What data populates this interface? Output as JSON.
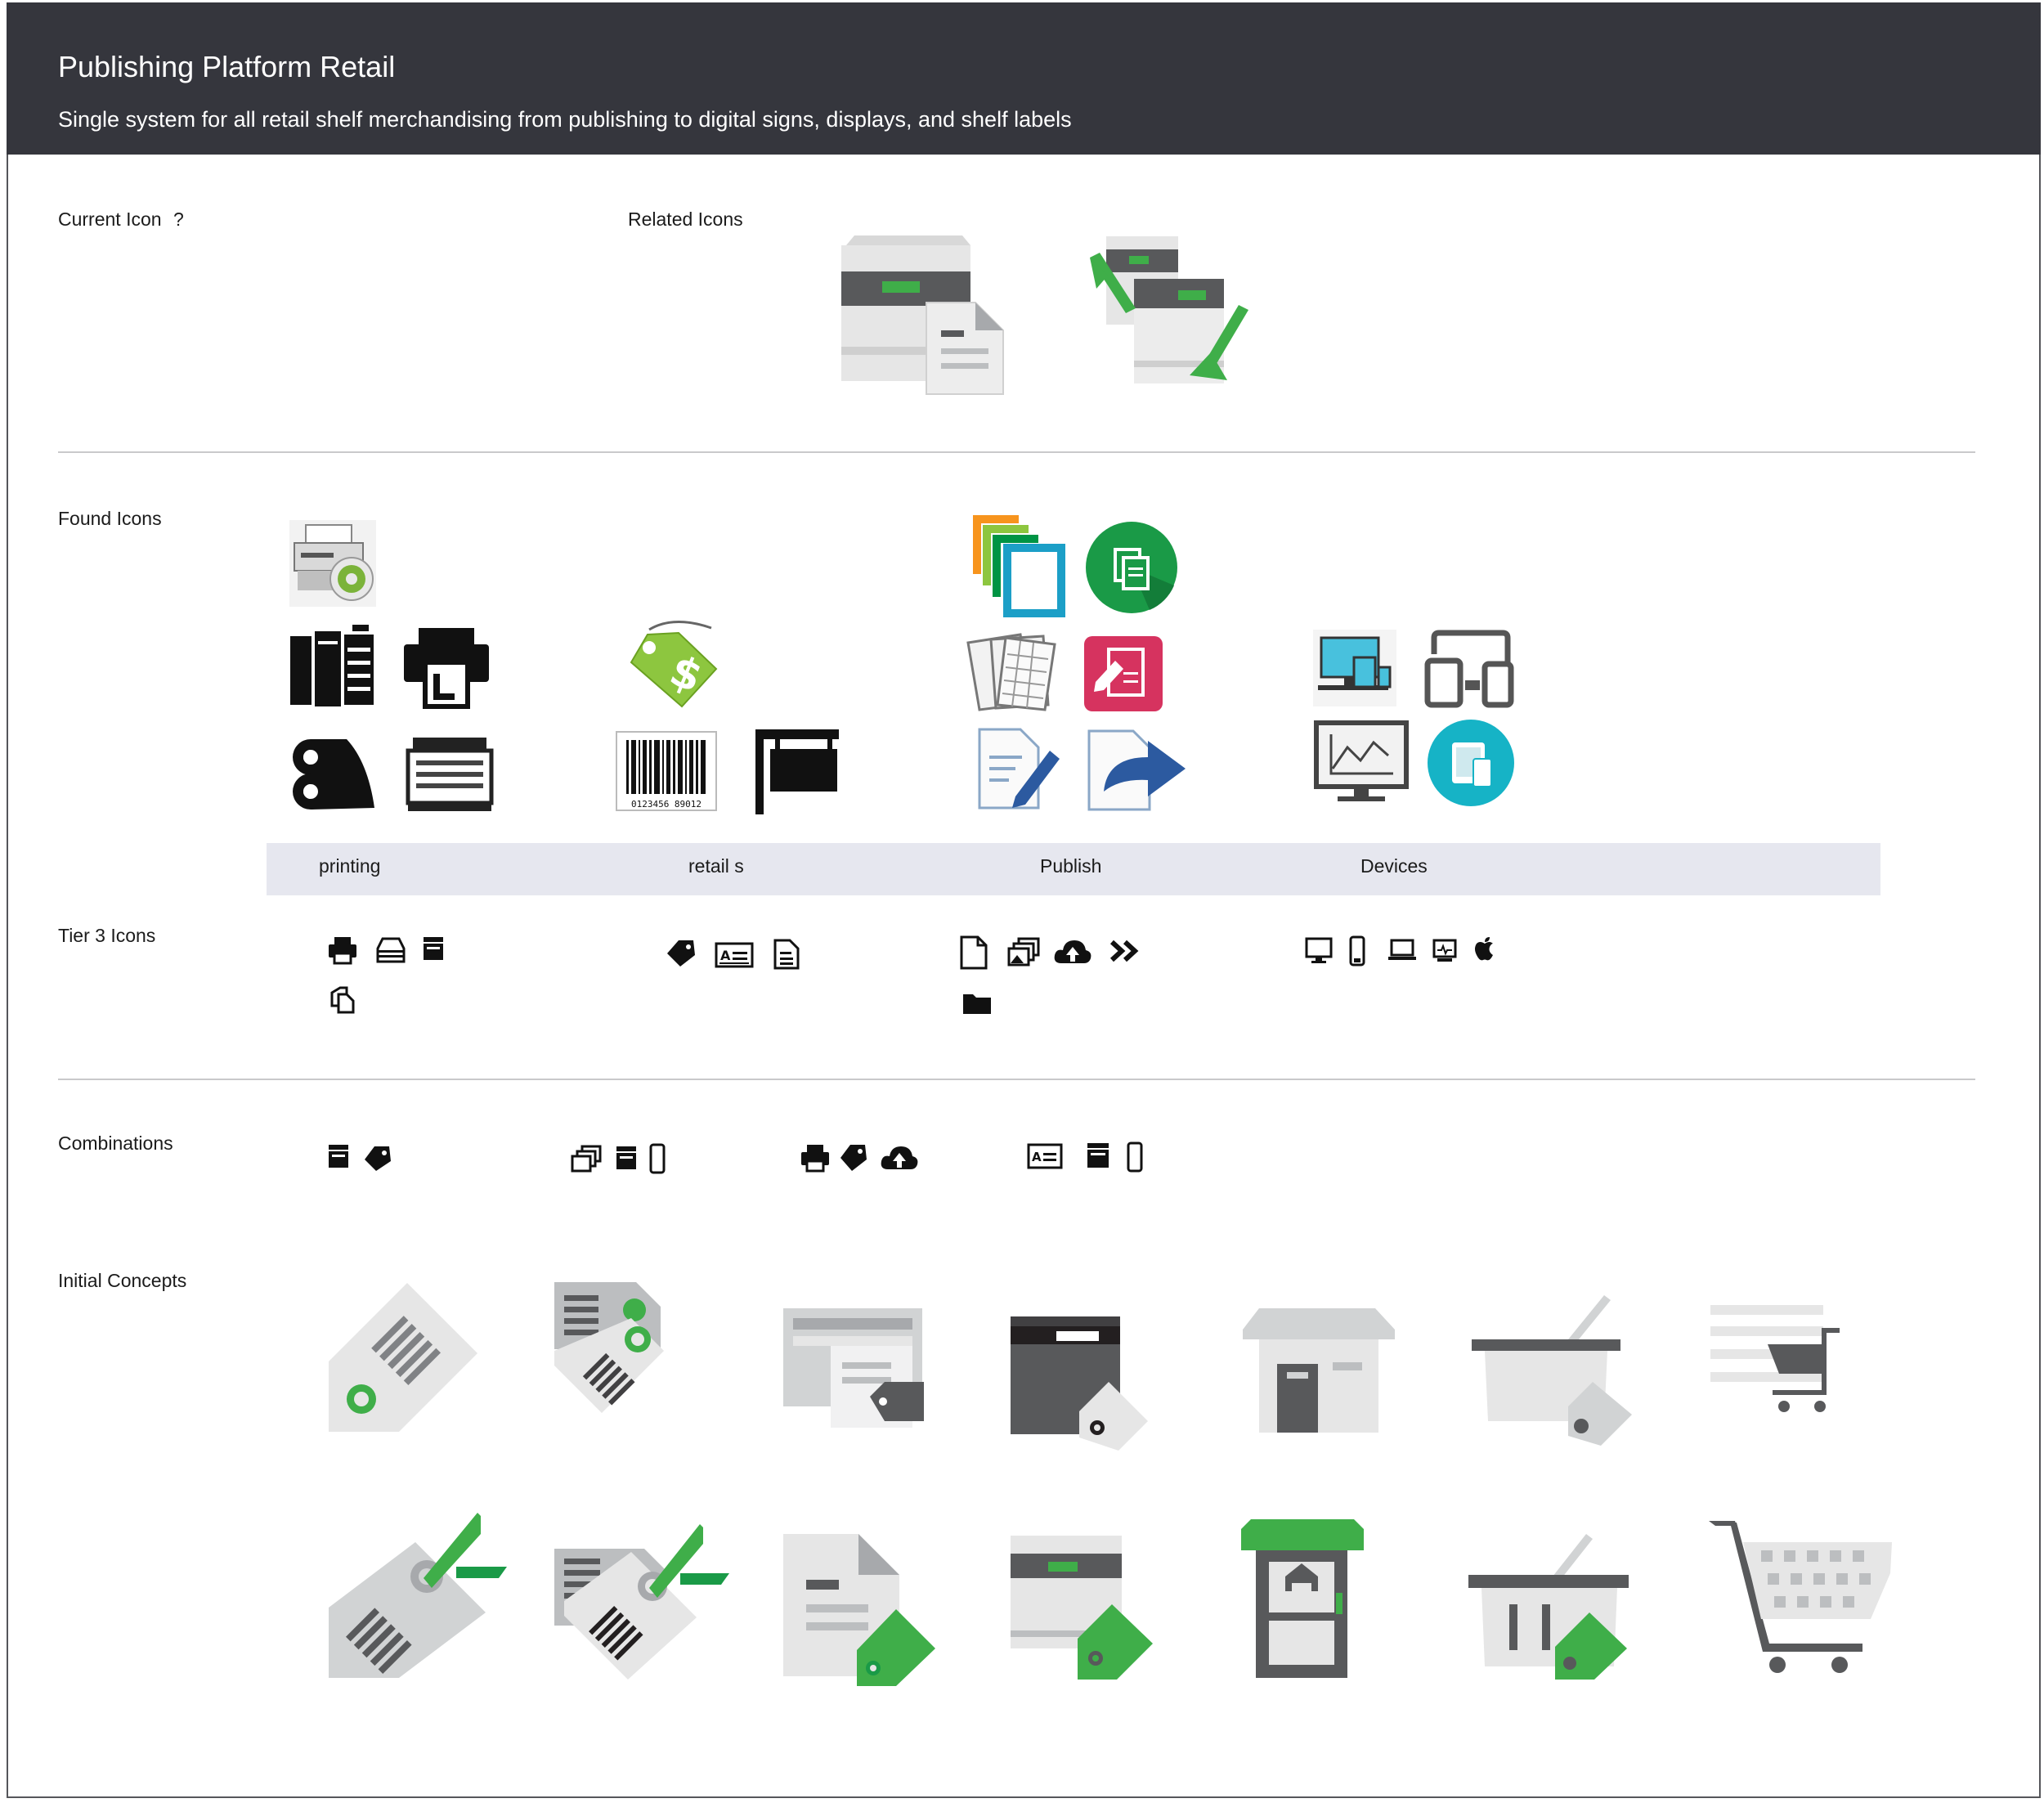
{
  "header": {
    "title": "Publishing Platform Retail",
    "subtitle": "Single system for all retail shelf merchandising from publishing to digital signs, displays, and shelf labels"
  },
  "sections": {
    "current_icon": "Current Icon",
    "help": "?",
    "related_icons": "Related Icons",
    "found_icons": "Found Icons",
    "tier3": "Tier 3 Icons",
    "combinations": "Combinations",
    "initial_concepts": "Initial Concepts"
  },
  "categories": [
    "printing",
    "retail s",
    "Publish",
    "Devices"
  ],
  "found_icons": {
    "barcode_number": "0123456 89012"
  },
  "colors": {
    "header_bg": "#35363d",
    "band_bg": "#e6e7ef",
    "green": "#3fae49",
    "dark_green": "#1a9a47",
    "gray_dark": "#58595b",
    "gray_light": "#e6e6e6",
    "teal": "#16b3c6",
    "pink": "#d6335f",
    "blue": "#2c5aa0"
  },
  "icons": {
    "related": [
      "printer-document-icon",
      "printer-transfer-icon"
    ],
    "found_printing": [
      "printer-settings-icon",
      "copier-icon",
      "printer-output-icon",
      "roll-printer-icon",
      "line-printer-icon"
    ],
    "found_retail": [
      "price-tag-dollar-icon",
      "barcode-icon",
      "hanging-sign-icon"
    ],
    "found_publish": [
      "layered-pages-icon",
      "copy-circle-icon",
      "spreadsheet-pages-icon",
      "edit-document-icon",
      "document-pencil-icon",
      "document-share-icon"
    ],
    "found_devices": [
      "multi-device-icon",
      "tablet-phone-icon",
      "monitor-chart-icon",
      "devices-circle-icon"
    ],
    "tier3_printing": [
      "printer-icon",
      "hdd-icon",
      "fax-icon",
      "copy-icon"
    ],
    "tier3_retail": [
      "tag-icon",
      "id-card-icon",
      "document-list-icon"
    ],
    "tier3_publish": [
      "file-icon",
      "images-icon",
      "cloud-upload-icon",
      "double-chevron-icon",
      "folder-icon"
    ],
    "tier3_devices": [
      "desktop-icon",
      "mobile-icon",
      "laptop-icon",
      "signage-icon",
      "apple-icon"
    ],
    "concepts_row1": [
      "tag-barcode-concept",
      "tags-document-concept",
      "window-tag-concept",
      "printer-tag-concept",
      "store-concept",
      "basket-tag-concept",
      "cart-lines-concept"
    ],
    "concepts_row2": [
      "tag-arrow-concept",
      "tags-arrow-concept",
      "document-tag-concept",
      "printer-green-tag-concept",
      "kiosk-concept",
      "basket-green-tag-concept",
      "cart-concept"
    ]
  }
}
